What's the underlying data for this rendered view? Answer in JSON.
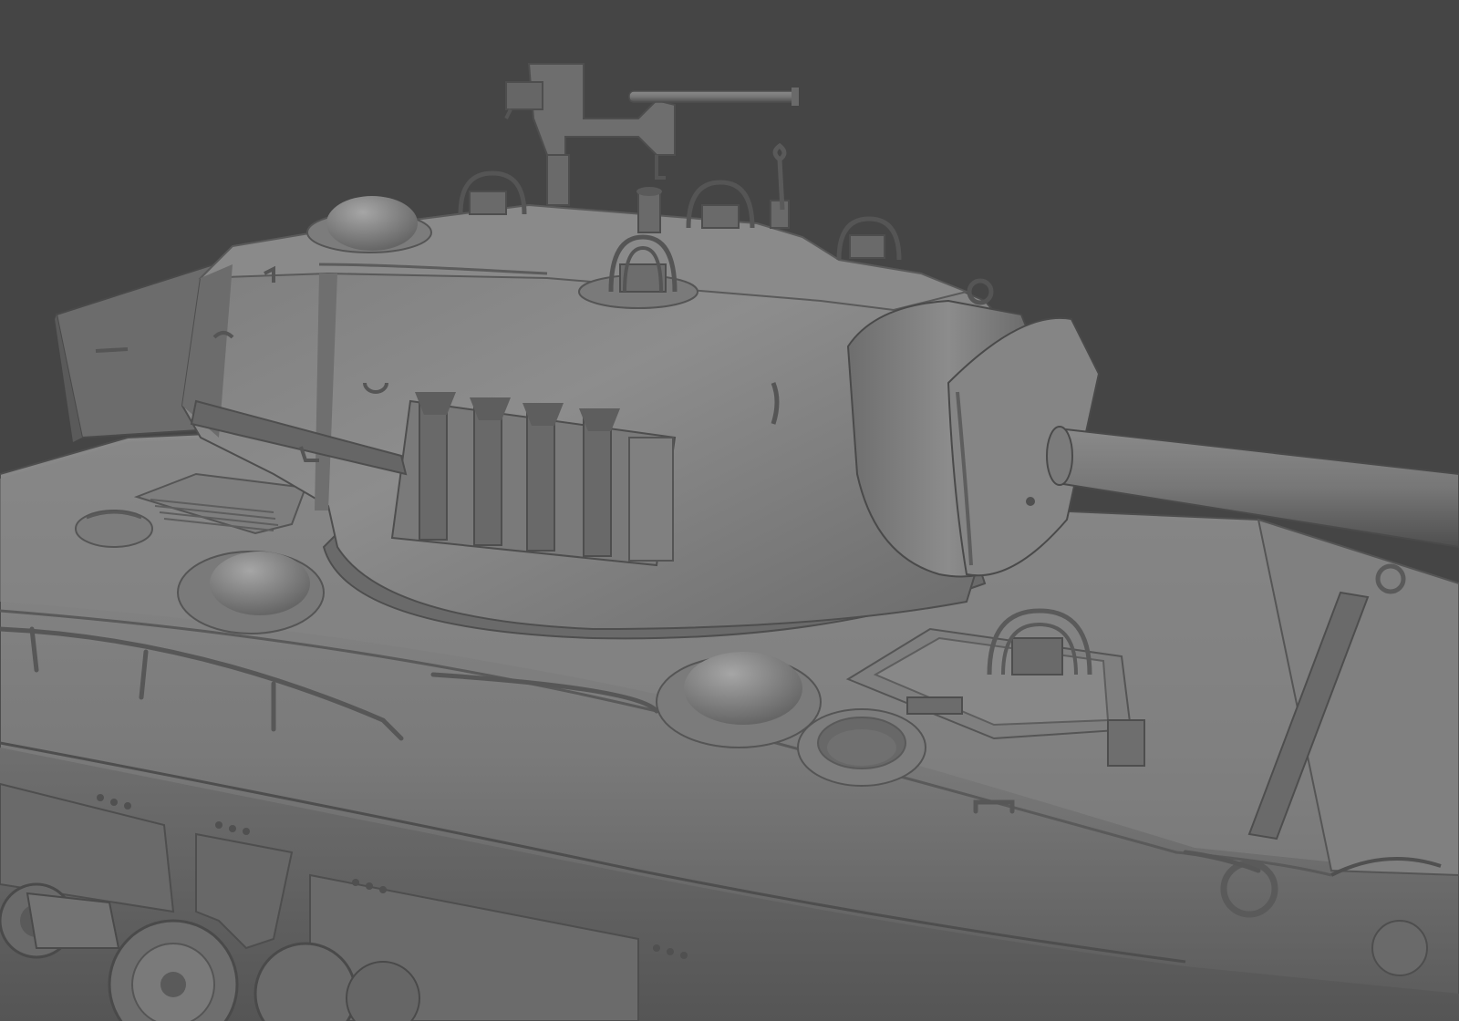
{
  "scene": {
    "subject": "",
    "colors": {
      "background": "#454545",
      "hull_light": "#8c8c8c",
      "hull_mid": "#777777",
      "hull_dark": "#555555",
      "turret_light": "#8e8e8e",
      "turret_dark": "#5f5f5f",
      "outline": "#4a4a4a",
      "highlight": "#a8a8a8"
    }
  }
}
